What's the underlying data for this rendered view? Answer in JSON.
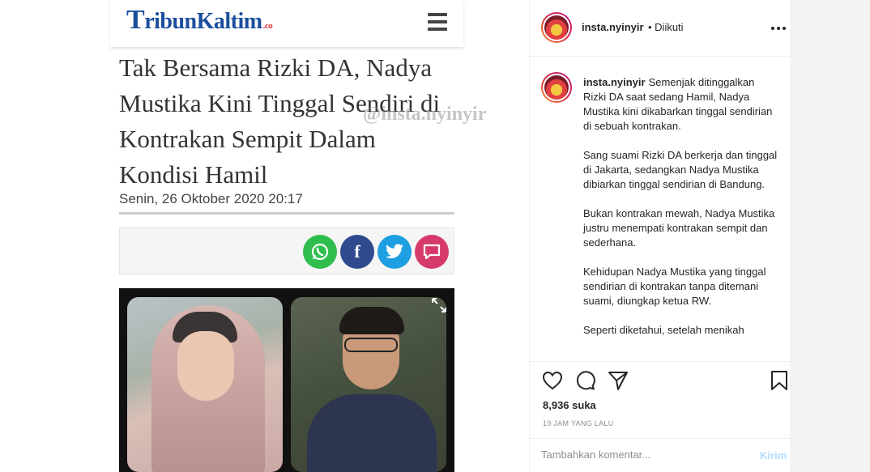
{
  "article": {
    "logo_big": "T",
    "logo_word": "ribunKaltim",
    "logo_suffix": ".co",
    "headline": "Tak Bersama Rizki DA, Nadya Mustika Kini Tinggal Sendiri di Kontrakan Sempit Dalam Kondisi Hamil",
    "watermark": "@insta.nyinyir",
    "date": "Senin, 26 Oktober 2020 20:17",
    "share_icons": [
      "whatsapp-icon",
      "facebook-icon",
      "twitter-icon",
      "comment-icon"
    ],
    "facebook_glyph": "f",
    "colors": {
      "brand": "#1b4f9c",
      "whatsapp": "#2fbe4e",
      "facebook": "#2f4a8f",
      "twitter": "#1d9fe2",
      "comment": "#d63a6b"
    }
  },
  "post": {
    "username": "insta.nyinyir",
    "follow_status": "• Diikuti",
    "caption_paragraphs": [
      "Semenjak ditinggalkan Rizki DA saat sedang Hamil, Nadya Mustika kini dikabarkan tinggal sendirian di sebuah kontrakan.",
      "Sang suami Rizki DA berkerja dan tinggal di Jakarta, sedangkan Nadya Mustika dibiarkan tinggal sendirian di Bandung.",
      "Bukan kontrakan mewah, Nadya Mustika justru menempati kontrakan sempit dan sederhana.",
      "Kehidupan Nadya Mustika yang tinggal sendirian di kontrakan tanpa ditemani suami, diungkap ketua RW.",
      "Seperti diketahui, setelah menikah"
    ],
    "likes": "8,936 suka",
    "time_ago": "19 JAM YANG LALU",
    "comment_placeholder": "Tambahkan komentar...",
    "post_button": "Kirim"
  }
}
